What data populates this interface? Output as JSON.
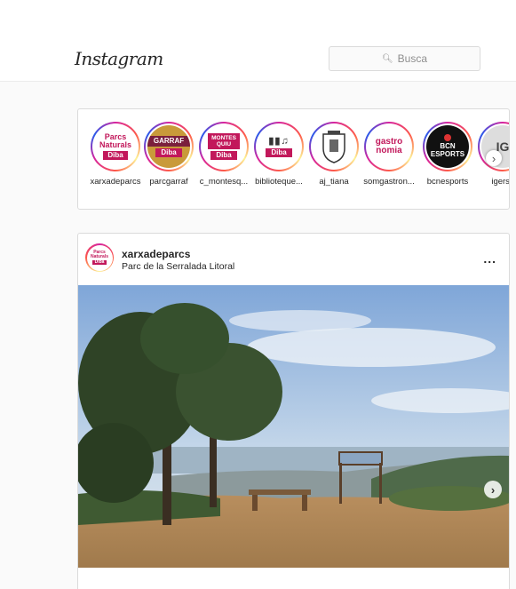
{
  "header": {
    "logo": "Instagram",
    "search": {
      "placeholder": "Busca",
      "icon": "search-icon"
    }
  },
  "stories": {
    "items": [
      {
        "label": "xarxadeparcs",
        "avatar_lines": [
          "Parcs",
          "Naturals",
          "Diba"
        ]
      },
      {
        "label": "parcgarraf",
        "avatar_lines": [
          "GARRAF",
          "Diba"
        ]
      },
      {
        "label": "c_montesq...",
        "avatar_lines": [
          "MONTES",
          "QUIU",
          "Diba"
        ]
      },
      {
        "label": "biblioteque...",
        "avatar_lines": [
          "Diba"
        ]
      },
      {
        "label": "aj_tiana",
        "avatar_lines": []
      },
      {
        "label": "somgastron...",
        "avatar_lines": [
          "gastro",
          "nomia"
        ]
      },
      {
        "label": "bcnesports",
        "avatar_lines": [
          "BCN",
          "ESPORTS"
        ]
      },
      {
        "label": "igersv",
        "avatar_lines": [
          "IG"
        ]
      }
    ],
    "next_icon": "chevron-right-icon"
  },
  "post": {
    "username": "xarxadeparcs",
    "location": "Parc de la Serralada Litoral",
    "more_label": "...",
    "avatar_lines": [
      "Parcs",
      "Naturals",
      "Diba"
    ],
    "carousel_next_icon": "chevron-right-icon"
  },
  "colors": {
    "brand_magenta": "#c2185b",
    "border": "#dbdbdb",
    "feed_bg": "#fafafa"
  }
}
